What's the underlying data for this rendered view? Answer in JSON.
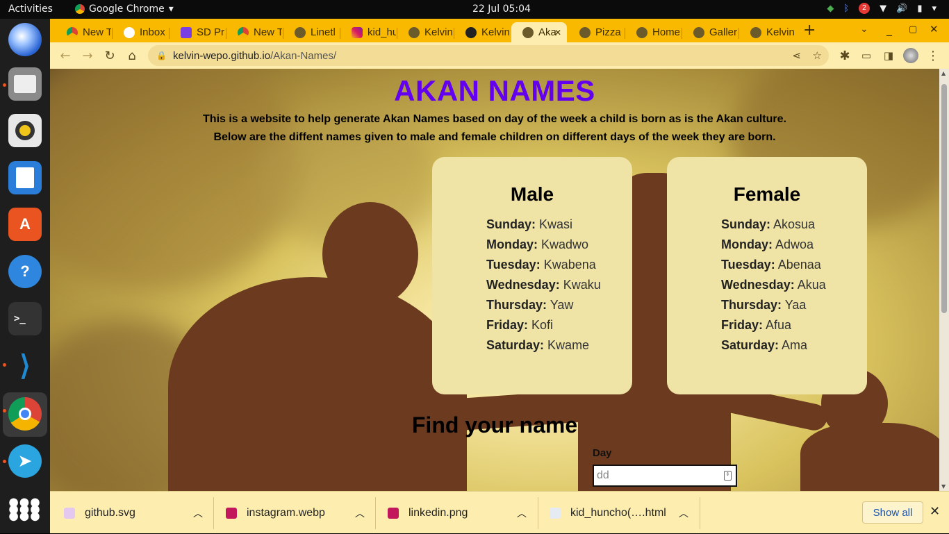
{
  "system_bar": {
    "activities": "Activities",
    "app_menu": "Google Chrome",
    "clock": "22 Jul  05:04",
    "notification_badge": "2"
  },
  "dock": {
    "apps": [
      "thunderbird-icon",
      "files-icon",
      "rhythmbox-icon",
      "writer-icon",
      "app-center-icon",
      "help-icon",
      "terminal-icon",
      "vscode-icon",
      "chrome-icon",
      "telegram-icon",
      "show-apps-icon"
    ]
  },
  "tabs": [
    {
      "label": "New T",
      "icon": "chrome-icon"
    },
    {
      "label": "Inbox",
      "icon": "gmail-icon"
    },
    {
      "label": "SD Pr",
      "icon": "doc-icon"
    },
    {
      "label": "New T",
      "icon": "chrome-icon"
    },
    {
      "label": "Linetl",
      "icon": "globe-icon"
    },
    {
      "label": "kid_hu",
      "icon": "instagram-icon"
    },
    {
      "label": "Kelvin",
      "icon": "globe-icon"
    },
    {
      "label": "Kelvin",
      "icon": "github-icon"
    },
    {
      "label": "Aka",
      "icon": "globe-icon",
      "active": true
    },
    {
      "label": "Pizza I",
      "icon": "globe-icon"
    },
    {
      "label": "Home",
      "icon": "globe-icon"
    },
    {
      "label": "Galler",
      "icon": "globe-icon"
    },
    {
      "label": "Kelvin",
      "icon": "globe-icon"
    }
  ],
  "address_bar": {
    "host": "kelvin-wepo.github.io",
    "path": "/Akan-Names/"
  },
  "page": {
    "title": "AKAN NAMES",
    "intro_line1": "This is a website to help generate Akan Names based on day of the week a child is born as is the Akan culture.",
    "intro_line2": "Below are the diffent names given to male and female children on different days of the week they are born.",
    "male": {
      "heading": "Male",
      "rows": [
        {
          "day": "Sunday:",
          "name": "Kwasi"
        },
        {
          "day": "Monday:",
          "name": "Kwadwo"
        },
        {
          "day": "Tuesday:",
          "name": "Kwabena"
        },
        {
          "day": "Wednesday:",
          "name": "Kwaku"
        },
        {
          "day": "Thursday:",
          "name": "Yaw"
        },
        {
          "day": "Friday:",
          "name": "Kofi"
        },
        {
          "day": "Saturday:",
          "name": "Kwame"
        }
      ]
    },
    "female": {
      "heading": "Female",
      "rows": [
        {
          "day": "Sunday:",
          "name": "Akosua"
        },
        {
          "day": "Monday:",
          "name": "Adwoa"
        },
        {
          "day": "Tuesday:",
          "name": "Abenaa"
        },
        {
          "day": "Wednesday:",
          "name": "Akua"
        },
        {
          "day": "Thursday:",
          "name": "Yaa"
        },
        {
          "day": "Friday:",
          "name": "Afua"
        },
        {
          "day": "Saturday:",
          "name": "Ama"
        }
      ]
    },
    "find_title": "Find your name",
    "day_label": "Day",
    "day_placeholder": "dd"
  },
  "downloads": {
    "items": [
      {
        "name": "github.svg",
        "color": "#e4c8f0"
      },
      {
        "name": "instagram.webp",
        "color": "#c2185b"
      },
      {
        "name": "linkedin.png",
        "color": "#c2185b"
      },
      {
        "name": "kid_huncho(….html",
        "color": "#e6eaf2"
      }
    ],
    "show_all": "Show all"
  }
}
